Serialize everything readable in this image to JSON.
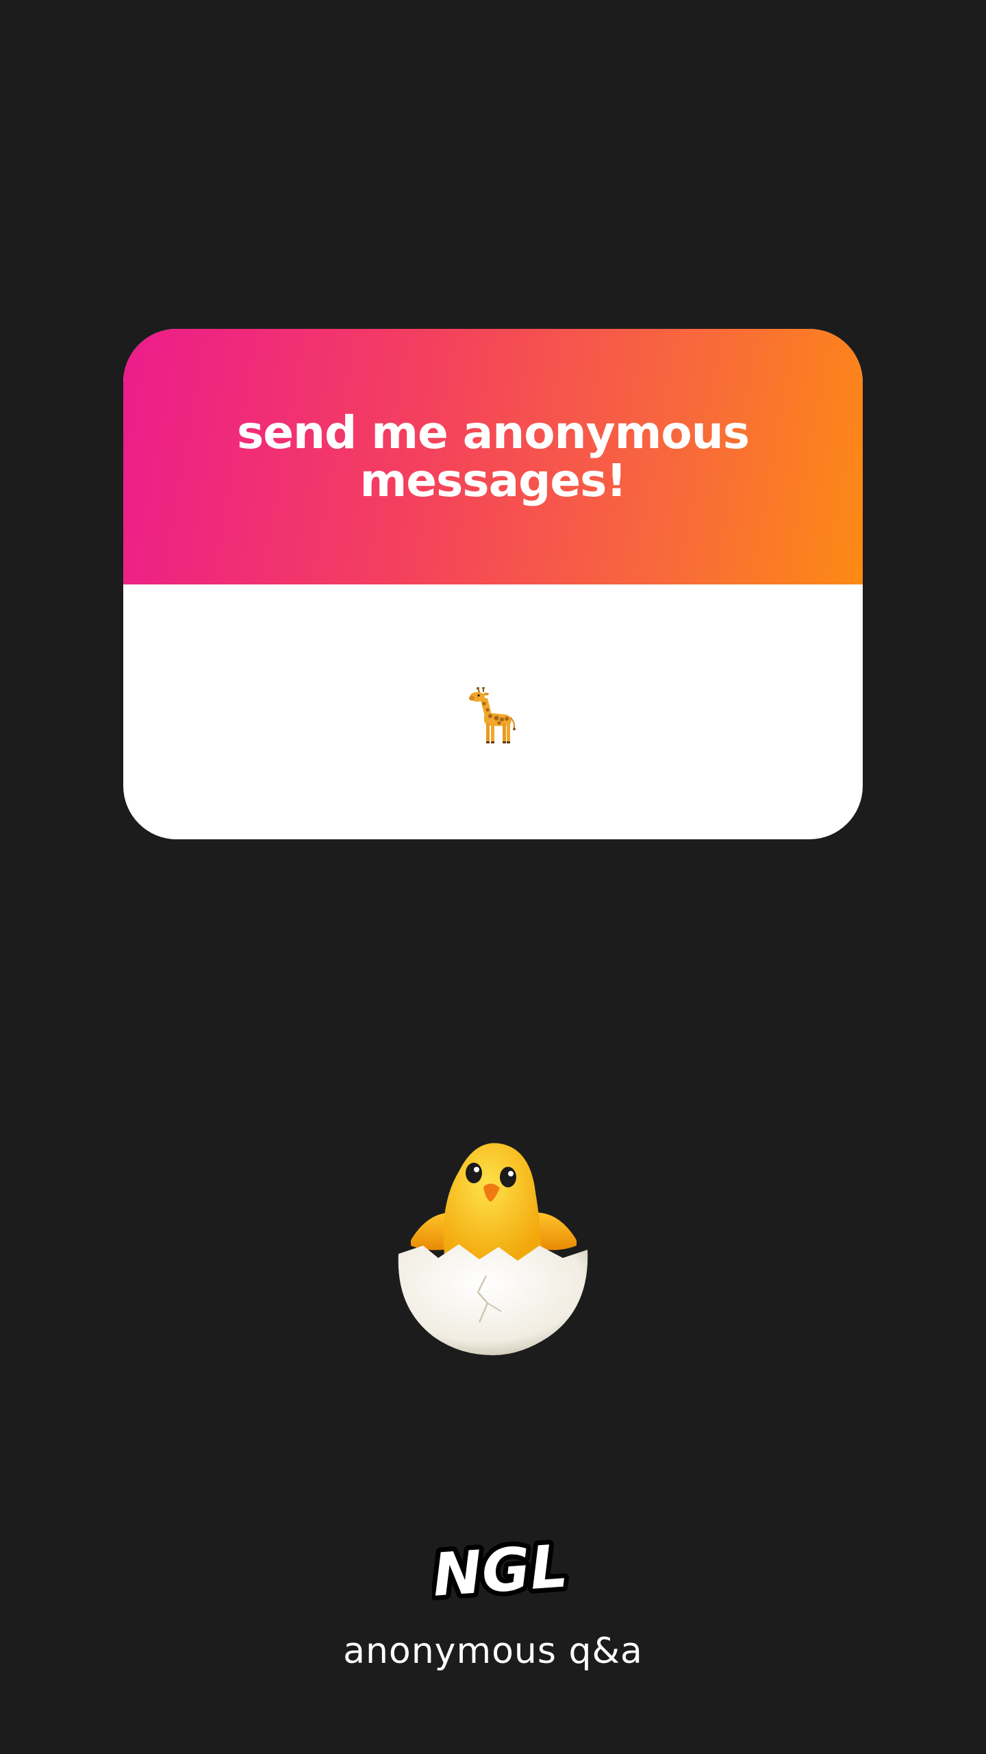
{
  "card": {
    "title": "send me anonymous messages!",
    "body_icon": "giraffe-icon"
  },
  "main": {
    "mascot_icon": "hatching-chick-icon"
  },
  "brand": {
    "logo": "NGL",
    "tagline": "anonymous q&a"
  },
  "colors": {
    "background": "#1c1c1d",
    "gradient_start": "#ec1c8c",
    "gradient_end": "#fd8a14",
    "card_body": "#ffffff"
  }
}
